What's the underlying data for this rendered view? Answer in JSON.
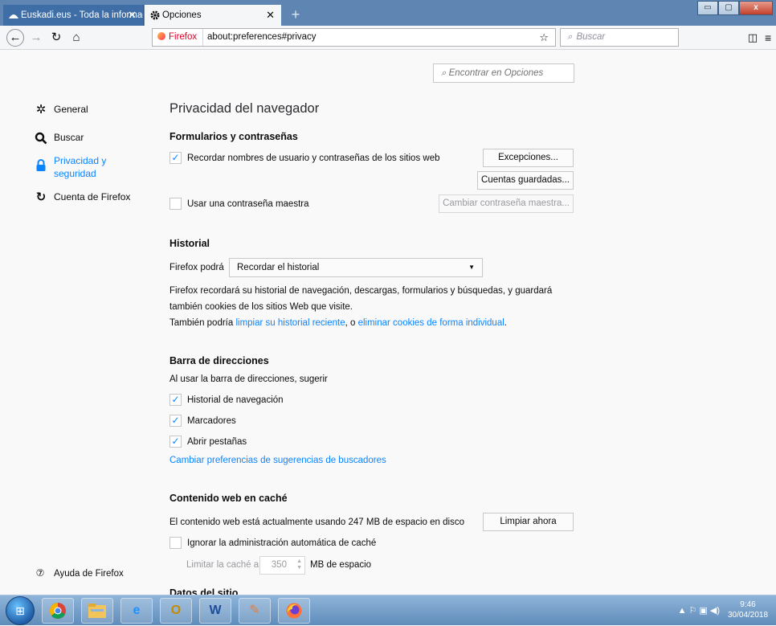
{
  "browser": {
    "tabs": [
      {
        "label": "Euskadi.eus - Toda la informac",
        "close": "✕"
      },
      {
        "label": "Opciones",
        "close": "✕"
      }
    ],
    "new_tab": "+",
    "window_controls": {
      "minimize": "▭",
      "maximize": "▢",
      "close": "x"
    },
    "nav": {
      "back": "←",
      "forward": "→",
      "reload": "↻",
      "home": "⌂"
    },
    "identity_label": "Firefox",
    "url": "about:preferences#privacy",
    "bookmark_star": "☆",
    "search_placeholder": "Buscar",
    "sidebar_icon": "◫",
    "menu_icon": "≡"
  },
  "prefs": {
    "find_placeholder": "⌕ Encontrar en Opciones",
    "categories": [
      {
        "label": "General",
        "icon": "gear-icon"
      },
      {
        "label": "Buscar",
        "icon": "search-icon"
      },
      {
        "label": "Privacidad y seguridad",
        "icon": "lock-icon",
        "selected": true
      },
      {
        "label": "Cuenta de Firefox",
        "icon": "sync-icon"
      }
    ],
    "help_label": "Ayuda de Firefox",
    "page_title": "Privacidad del navegador",
    "forms": {
      "title": "Formularios y contraseñas",
      "remember_label": "Recordar nombres de usuario y contraseñas de los sitios web",
      "remember_checked": true,
      "exceptions_button": "Excepciones...",
      "saved_logins_button": "Cuentas guardadas...",
      "master_password_label": "Usar una contraseña maestra",
      "master_password_checked": false,
      "change_master_button": "Cambiar contraseña maestra..."
    },
    "history": {
      "title": "Historial",
      "will_label": "Firefox podrá",
      "mode_selected": "Recordar el historial",
      "caret": "▼",
      "desc_line1": "Firefox recordará su historial de navegación, descargas, formularios y búsquedas, y guardará",
      "desc_line2": "también cookies de los sitios Web que visite.",
      "also_prefix": "También podría ",
      "clear_recent_link": "limpiar su historial reciente",
      "or_text": ", o ",
      "remove_cookies_link": "eliminar cookies de forma individual",
      "period": "."
    },
    "urlbar": {
      "title": "Barra de direcciones",
      "intro": "Al usar la barra de direcciones, sugerir",
      "options": [
        {
          "label": "Historial de navegación",
          "checked": true
        },
        {
          "label": "Marcadores",
          "checked": true
        },
        {
          "label": "Abrir pestañas",
          "checked": true
        }
      ],
      "change_suggestions_link": "Cambiar preferencias de sugerencias de buscadores"
    },
    "cache": {
      "title": "Contenido web en caché",
      "usage_text": "El contenido web está actualmente usando 247 MB de espacio en disco",
      "clear_button": "Limpiar ahora",
      "override_label": "Ignorar la administración automática de caché",
      "override_checked": false,
      "limit_label": "Limitar la caché a",
      "limit_value": "350",
      "limit_unit": "MB de espacio"
    },
    "next_section_partial": "Datos del sitio"
  },
  "taskbar": {
    "apps": [
      "chrome-icon",
      "explorer-icon",
      "ie-icon",
      "outlook-icon",
      "word-icon",
      "paint-icon",
      "firefox-icon"
    ],
    "tray_icons": "▲  ⚐  ▣  ◀)",
    "time": "9:46",
    "date": "30/04/2018"
  }
}
